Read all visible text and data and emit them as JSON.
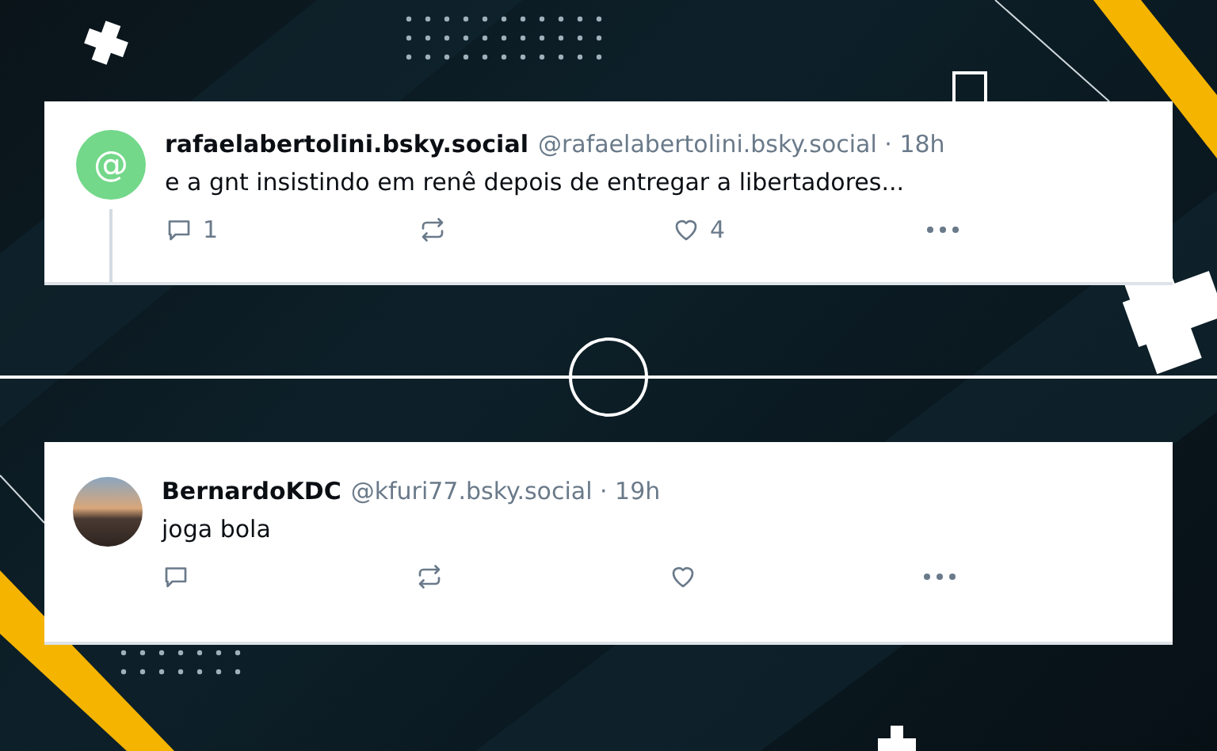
{
  "posts": [
    {
      "avatar": {
        "kind": "symbol",
        "text": "@"
      },
      "display_name": "rafaelabertolini.bsky.social",
      "meta": "@rafaelabertolini.bsky.social · 18h",
      "text": "e a gnt insistindo em renê depois de entregar a libertadores...",
      "thread_line": true,
      "reply_count": "1",
      "like_count": "4"
    },
    {
      "avatar": {
        "kind": "photo"
      },
      "display_name": "BernardoKDC",
      "meta": "@kfuri77.bsky.social · 19h",
      "text": "joga bola",
      "thread_line": false
    }
  ]
}
